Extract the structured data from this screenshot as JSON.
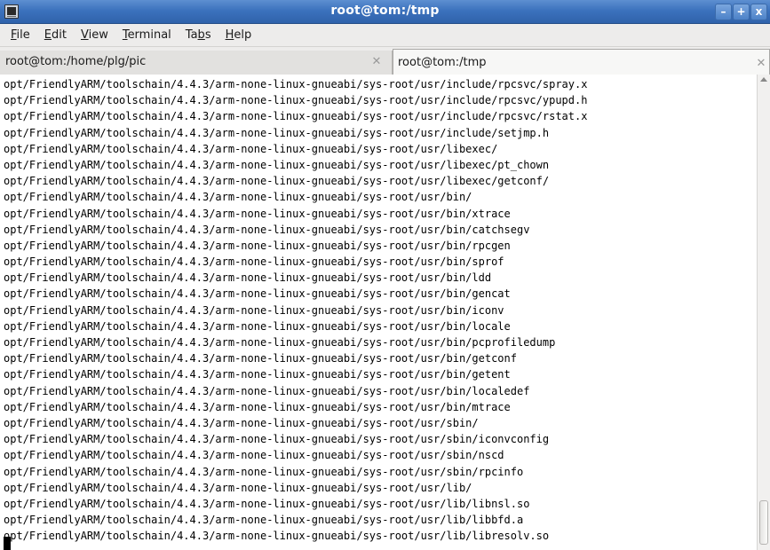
{
  "window": {
    "title": "root@tom:/tmp",
    "buttons": {
      "minimize": "–",
      "maximize": "+",
      "close": "x"
    }
  },
  "menubar": {
    "items": [
      {
        "mnemonic": "F",
        "rest": "ile"
      },
      {
        "mnemonic": "E",
        "rest": "dit"
      },
      {
        "mnemonic": "V",
        "rest": "iew"
      },
      {
        "mnemonic": "T",
        "rest": "erminal"
      },
      {
        "pre": "Ta",
        "mnemonic": "b",
        "rest": "s"
      },
      {
        "mnemonic": "H",
        "rest": "elp"
      }
    ]
  },
  "tabs": [
    {
      "label": "root@tom:/home/plg/pic",
      "active": false,
      "close_glyph": "✕"
    },
    {
      "label": "root@tom:/tmp",
      "active": true,
      "close_glyph": "✕"
    }
  ],
  "terminal": {
    "lines": [
      "opt/FriendlyARM/toolschain/4.4.3/arm-none-linux-gnueabi/sys-root/usr/include/rpcsvc/spray.x",
      "opt/FriendlyARM/toolschain/4.4.3/arm-none-linux-gnueabi/sys-root/usr/include/rpcsvc/ypupd.h",
      "opt/FriendlyARM/toolschain/4.4.3/arm-none-linux-gnueabi/sys-root/usr/include/rpcsvc/rstat.x",
      "opt/FriendlyARM/toolschain/4.4.3/arm-none-linux-gnueabi/sys-root/usr/include/setjmp.h",
      "opt/FriendlyARM/toolschain/4.4.3/arm-none-linux-gnueabi/sys-root/usr/libexec/",
      "opt/FriendlyARM/toolschain/4.4.3/arm-none-linux-gnueabi/sys-root/usr/libexec/pt_chown",
      "opt/FriendlyARM/toolschain/4.4.3/arm-none-linux-gnueabi/sys-root/usr/libexec/getconf/",
      "opt/FriendlyARM/toolschain/4.4.3/arm-none-linux-gnueabi/sys-root/usr/bin/",
      "opt/FriendlyARM/toolschain/4.4.3/arm-none-linux-gnueabi/sys-root/usr/bin/xtrace",
      "opt/FriendlyARM/toolschain/4.4.3/arm-none-linux-gnueabi/sys-root/usr/bin/catchsegv",
      "opt/FriendlyARM/toolschain/4.4.3/arm-none-linux-gnueabi/sys-root/usr/bin/rpcgen",
      "opt/FriendlyARM/toolschain/4.4.3/arm-none-linux-gnueabi/sys-root/usr/bin/sprof",
      "opt/FriendlyARM/toolschain/4.4.3/arm-none-linux-gnueabi/sys-root/usr/bin/ldd",
      "opt/FriendlyARM/toolschain/4.4.3/arm-none-linux-gnueabi/sys-root/usr/bin/gencat",
      "opt/FriendlyARM/toolschain/4.4.3/arm-none-linux-gnueabi/sys-root/usr/bin/iconv",
      "opt/FriendlyARM/toolschain/4.4.3/arm-none-linux-gnueabi/sys-root/usr/bin/locale",
      "opt/FriendlyARM/toolschain/4.4.3/arm-none-linux-gnueabi/sys-root/usr/bin/pcprofiledump",
      "opt/FriendlyARM/toolschain/4.4.3/arm-none-linux-gnueabi/sys-root/usr/bin/getconf",
      "opt/FriendlyARM/toolschain/4.4.3/arm-none-linux-gnueabi/sys-root/usr/bin/getent",
      "opt/FriendlyARM/toolschain/4.4.3/arm-none-linux-gnueabi/sys-root/usr/bin/localedef",
      "opt/FriendlyARM/toolschain/4.4.3/arm-none-linux-gnueabi/sys-root/usr/bin/mtrace",
      "opt/FriendlyARM/toolschain/4.4.3/arm-none-linux-gnueabi/sys-root/usr/sbin/",
      "opt/FriendlyARM/toolschain/4.4.3/arm-none-linux-gnueabi/sys-root/usr/sbin/iconvconfig",
      "opt/FriendlyARM/toolschain/4.4.3/arm-none-linux-gnueabi/sys-root/usr/sbin/nscd",
      "opt/FriendlyARM/toolschain/4.4.3/arm-none-linux-gnueabi/sys-root/usr/sbin/rpcinfo",
      "opt/FriendlyARM/toolschain/4.4.3/arm-none-linux-gnueabi/sys-root/usr/lib/",
      "opt/FriendlyARM/toolschain/4.4.3/arm-none-linux-gnueabi/sys-root/usr/lib/libnsl.so",
      "opt/FriendlyARM/toolschain/4.4.3/arm-none-linux-gnueabi/sys-root/usr/lib/libbfd.a",
      "opt/FriendlyARM/toolschain/4.4.3/arm-none-linux-gnueabi/sys-root/usr/lib/libresolv.so"
    ]
  },
  "icons": {
    "app": "terminal-icon",
    "tab_close": "close-icon",
    "scroll_up": "arrow-up-icon"
  },
  "colors": {
    "titlebar": "#3c72bd",
    "title_text": "#ffffff",
    "menubar": "#edeceb",
    "terminal_bg": "#ffffff",
    "terminal_fg": "#000000"
  }
}
